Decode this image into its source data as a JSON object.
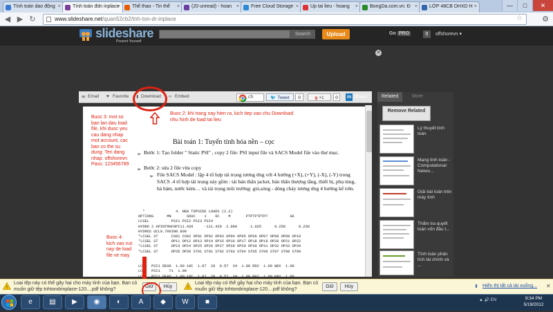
{
  "browser": {
    "tabs": [
      {
        "label": "Tính toán dao động",
        "active": false,
        "icon_color": "#3a7bd5"
      },
      {
        "label": "Tính toán đdn inplace",
        "active": true,
        "icon_color": "#7a3d98"
      },
      {
        "label": "Thể thao - Tin thể",
        "active": false,
        "icon_color": "#e65c00"
      },
      {
        "label": "(20 unread) - hoan",
        "active": false,
        "icon_color": "#6a3fa0"
      },
      {
        "label": "Free Cloud Storage",
        "active": false,
        "icon_color": "#2c8ad6"
      },
      {
        "label": "Up tai lieu - hoang",
        "active": false,
        "icon_color": "#d33"
      },
      {
        "label": "BongDa.com.vn: Đ",
        "active": false,
        "icon_color": "#2a8a2a"
      },
      {
        "label": "LỚP 48CB DHXD H",
        "active": false,
        "icon_color": "#3366aa"
      }
    ],
    "url_host": "www.slideshare.net",
    "url_path": "/quan52cb2/tnh-ton-dr-inplace",
    "window_controls": [
      "—",
      "□",
      "✕"
    ]
  },
  "slideshare": {
    "logo_text": "slideshare",
    "tagline": "Present Yourself",
    "search_button": "Search",
    "upload_button": "Upload",
    "go_label": "Go",
    "pro_label": "PRO",
    "notif_count": "0",
    "username": "offshorevn ▾",
    "close_ad": "✕"
  },
  "viewer_toolbar": {
    "email": "Email",
    "favorite": "Favorite",
    "download": "Download",
    "embed": "Embed",
    "tweet": "Tweet",
    "tweet_count": "0",
    "gplus": "+1",
    "gplus_count": "0",
    "share": "Share"
  },
  "annotations": {
    "step2": "Buoc 2: khi trang nay hien ra, kich tiep vao chu Download nhu hinh de load tai lieu",
    "step3": "Buoc 3: mot so ban lan dau load file, khi duoc yeu cau dang nhap mot account, cac ban co the su dung: Ten dang nhap: offshorevn Pass: 123456789",
    "step4": "Buoc 4: kich vao nut nay de load file ve may"
  },
  "document": {
    "title": "Bài toán 1: Tuyến tính hóa nền – cọc",
    "bullet1": "Bước 1: Tạo folder \" Static PSI\" , copy 2 file: PSI input file và SACS Model file vào thư mục.",
    "bullet2": "Bước 2: sửa 2 file vừa copy",
    "sub1": "File SACS Model : lập 4 tổ hợp tải trọng tương ứng với 4 hướng (+X), (+Y), (-X), (-Y) trong SACS .4 tổ hợp tải trọng này gồm : tải bản thân jacket, bản thân thượng tầng, thiết bị, phụ tùng, hà bám, nước kèm… và tải trọng môi trường: gió,sóng - dòng chảy tương ứng 4 hướng kể trên.",
    "code": "  *              4. NEW TOPSIDE LOADS (2.2)\nOPTIONS      MN       SDUC    1    6C    M       PTPTPTPTPT          SK\nLCSEL          PSI1 PSI2 PSI3 PSI4\nHYDRO 2 APINTMAF0PI11.420     -111.420  2.000      1.025      0.250      0.250\nHYDRO2 UCL0.700IN0.800\n*LCSEL ST      CS01 CS02 OP01 OP02 OP03 OP04 OP05 OP06 OP07 OP08 OP09 OP10\n*LCSEL ST      OP11 OP12 OP13 OP14 OP15 OP16 OP17 OP18 OP19 OP20 OP21 OP22\n*LCSEL ST      OP23 OP24 OP25 OP26 OP27 OP28 OP29 OP30 OP31 OP32 OP33 OP34\n*LCSEL ST      OP35 OP36 ST01 ST01 ST02 ST03 ST04 ST05 ST06 ST07 ST08 ST09\n\n\nLC    PSI1 DEAD  1.00 18C  1.07  20  0.57  34  1.00 RD2  1.00 WDX  1.00\nLCO   PSI1    71  1.00\nLCO   PSI1 DEAD  1.00 18C  1.07  20  0.57  34  1.00 RA2  1.00 WAY  1.00"
  },
  "sidebar": {
    "tab_related": "Related",
    "tab_more": "More",
    "remove_related": "Remove Related",
    "items": [
      {
        "title": "Lý thuyết tính toán"
      },
      {
        "title": "Mạng tính toán - Computational Netwo..."
      },
      {
        "title": "Giải bài toán trên máy tính"
      },
      {
        "title": "Thẩm tra quyết toán vốn đầu t..."
      },
      {
        "title": "Tính toán phân tích tài chính và ..."
      }
    ]
  },
  "downloads": {
    "item1": "Loại tệp này có thể gây hại cho máy tính của bạn. Bạn có muốn giữ tệp tnhtondrinplace-120....pdf không?",
    "item2": "Loại tệp này có thể gây hại cho máy tính của bạn. Bạn có muốn giữ tệp tnhtondrinplace-120....pdf không?",
    "keep": "Giữ",
    "discard": "Hủy",
    "show_all": "Hiển thị tất cả tài xuống...",
    "close": "✕"
  },
  "taskbar": {
    "tray": "▲ 🔊 EN",
    "time": "9:34 PM",
    "date": "5/19/2012"
  },
  "colors": {
    "annotation_red": "#dd2211",
    "upload_orange": "#e88a1a",
    "slideshare_blue": "#8ab4d8"
  }
}
